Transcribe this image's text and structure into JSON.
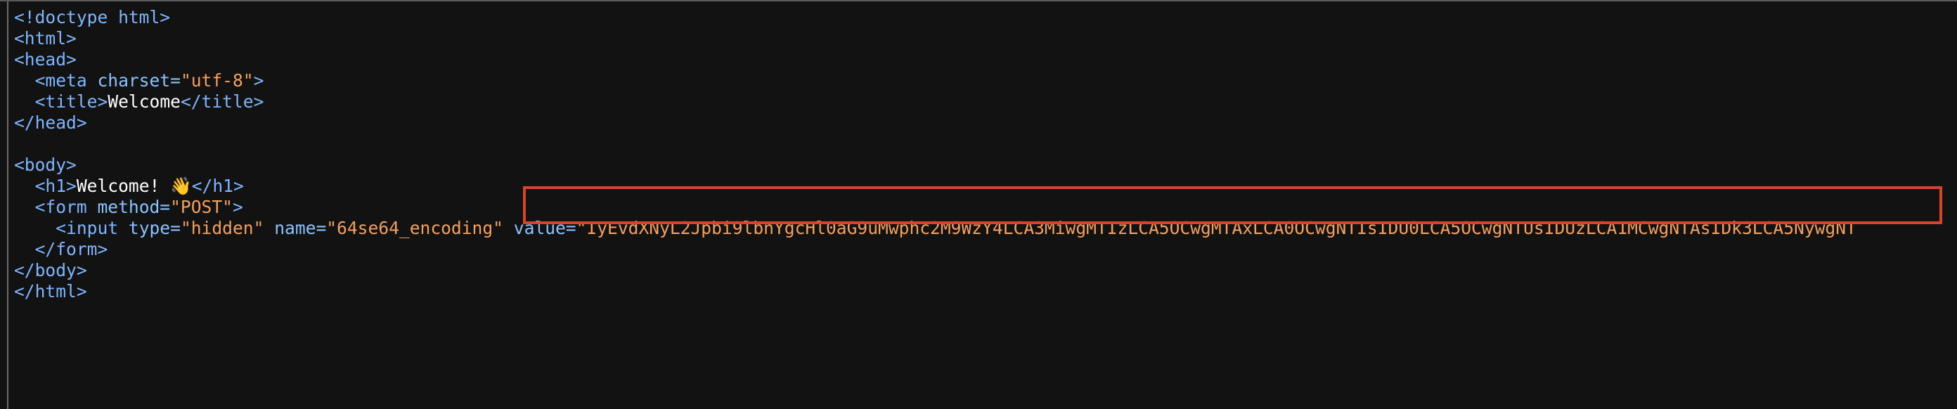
{
  "lines": [
    {
      "parts": [
        {
          "t": "tag",
          "s": "<!doctype html>"
        }
      ]
    },
    {
      "parts": [
        {
          "t": "tag",
          "s": "<html>"
        }
      ]
    },
    {
      "parts": [
        {
          "t": "tag",
          "s": "<head>"
        }
      ]
    },
    {
      "parts": [
        {
          "t": "punct",
          "s": "  "
        },
        {
          "t": "tag",
          "s": "<meta "
        },
        {
          "t": "attr",
          "s": "charset="
        },
        {
          "t": "val",
          "s": "\"utf-8\""
        },
        {
          "t": "tag",
          "s": ">"
        }
      ]
    },
    {
      "parts": [
        {
          "t": "punct",
          "s": "  "
        },
        {
          "t": "tag",
          "s": "<title>"
        },
        {
          "t": "txt",
          "s": "Welcome"
        },
        {
          "t": "tag",
          "s": "</title>"
        }
      ]
    },
    {
      "parts": [
        {
          "t": "tag",
          "s": "</head>"
        }
      ]
    },
    {
      "parts": [
        {
          "t": "punct",
          "s": ""
        }
      ]
    },
    {
      "parts": [
        {
          "t": "tag",
          "s": "<body>"
        }
      ]
    },
    {
      "parts": [
        {
          "t": "punct",
          "s": "  "
        },
        {
          "t": "tag",
          "s": "<h1>"
        },
        {
          "t": "txt",
          "s": "Welcome! 👋"
        },
        {
          "t": "tag",
          "s": "</h1>"
        }
      ]
    },
    {
      "parts": [
        {
          "t": "punct",
          "s": "  "
        },
        {
          "t": "tag",
          "s": "<form "
        },
        {
          "t": "attr",
          "s": "method="
        },
        {
          "t": "val",
          "s": "\"POST\""
        },
        {
          "t": "tag",
          "s": ">"
        }
      ]
    },
    {
      "parts": [
        {
          "t": "punct",
          "s": "    "
        },
        {
          "t": "tag",
          "s": "<input "
        },
        {
          "t": "attr",
          "s": "type="
        },
        {
          "t": "val",
          "s": "\"hidden\""
        },
        {
          "t": "attr",
          "s": " name="
        },
        {
          "t": "val",
          "s": "\"64se64_encoding\""
        },
        {
          "t": "attr",
          "s": " value="
        },
        {
          "t": "val",
          "s": "\"IyEvdXNyL2Jpbi9lbnYgcHl0aG9uMwphc2M9WzY4LCA3MiwgMTIzLCA5OCwgMTAxLCA0OCwgNTIsIDU0LCA5OCwgNTUsIDUzLCA1MCwgNTAsIDk3LCA5NywgNT"
        }
      ]
    },
    {
      "parts": [
        {
          "t": "punct",
          "s": "  "
        },
        {
          "t": "tag",
          "s": "</form>"
        }
      ]
    },
    {
      "parts": [
        {
          "t": "tag",
          "s": "</body>"
        }
      ]
    },
    {
      "parts": [
        {
          "t": "tag",
          "s": "</html>"
        }
      ]
    }
  ],
  "colors": {
    "background": "#121212",
    "tag": "#7fb5ff",
    "attribute": "#8cc2ff",
    "string": "#f3a05f",
    "text": "#ffffff",
    "highlight_box": "#d6452a"
  }
}
